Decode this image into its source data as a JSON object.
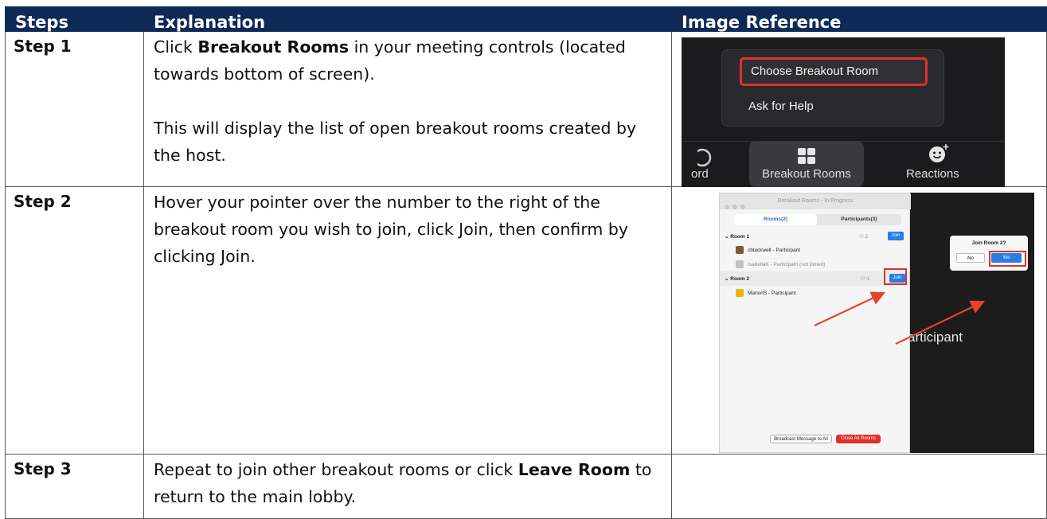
{
  "header": {
    "col1": "Steps",
    "col2": "Explanation",
    "col3": "Image Reference"
  },
  "rows": [
    {
      "step": "Step 1",
      "text_before": "Click ",
      "bold": "Breakout Rooms",
      "text_after": " in your meeting controls (located towards bottom of screen).",
      "text2": "This will display the list of open breakout rooms created by the host."
    },
    {
      "step": "Step 2",
      "text": "Hover your pointer over the number to the right of the breakout room you wish to join, click Join, then confirm by clicking Join."
    },
    {
      "step": "Step 3",
      "text_before": "Repeat to join other breakout rooms or click ",
      "bold": "Leave Room",
      "text_after": " to return to the main lobby."
    }
  ],
  "image1": {
    "menu_choose": "Choose Breakout Room",
    "menu_help": "Ask for Help",
    "bar_left": "ord",
    "bar_mid": "Breakout Rooms",
    "bar_right": "Reactions",
    "icons": [
      "record-icon",
      "grid-icon",
      "emoji-plus-icon"
    ],
    "highlight_color": "#e03030"
  },
  "image2": {
    "window_title": "Breakout Rooms - In Progress",
    "tab_rooms": "Rooms(2)",
    "tab_participants": "Participants(3)",
    "room1": "Room 1",
    "room1_count": "2",
    "room1_p1": "cblackwell - Participant",
    "room1_p2": "IsabellaK - Participant (not joined)",
    "room2": "Room 2",
    "room2_count": "1",
    "room2_p1": "MarionS - Participant",
    "join_label": "Join",
    "dialog_title": "Join Room 2?",
    "dialog_no": "No",
    "dialog_yes": "Yes",
    "broadcast": "Broadcast Message to All",
    "close_all": "Close All Rooms",
    "background_text": "articipant",
    "accent_color": "#2a7ce6"
  }
}
